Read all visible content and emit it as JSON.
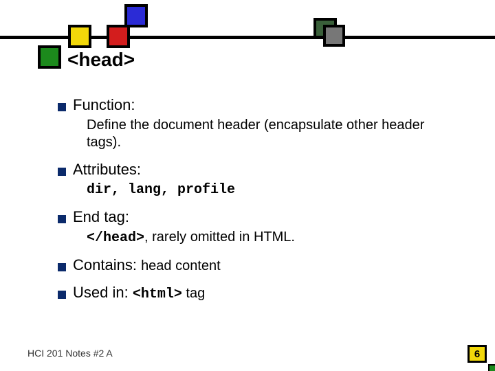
{
  "slide": {
    "title": "<head>"
  },
  "items": {
    "function": {
      "label": "Function:",
      "body": "Define the document header (encapsulate other header tags)."
    },
    "attributes": {
      "label": "Attributes:",
      "body": "dir, lang, profile"
    },
    "endtag": {
      "label": "End tag:",
      "code": "</head>",
      "rest": ", rarely omitted in HTML."
    },
    "contains": {
      "label": "Contains: ",
      "body": "head content"
    },
    "usedin": {
      "label": "Used in: ",
      "code": "<html>",
      "rest": " tag"
    }
  },
  "footer": {
    "note": "HCI 201 Notes #2 A",
    "page": "6"
  }
}
